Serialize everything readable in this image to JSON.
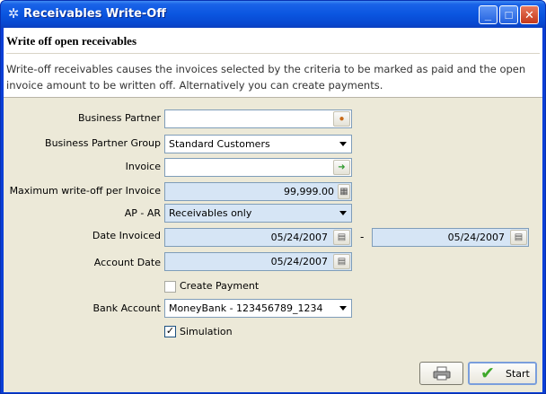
{
  "window": {
    "title": "Receivables Write-Off"
  },
  "header": {
    "title": "Write off open receivables",
    "description": "Write-off receivables causes the invoices selected by the criteria to be marked as paid and the open invoice amount to be written off. Alternatively you can create payments."
  },
  "form": {
    "business_partner": {
      "label": "Business Partner",
      "value": ""
    },
    "business_partner_group": {
      "label": "Business Partner Group",
      "value": "Standard Customers"
    },
    "invoice": {
      "label": "Invoice",
      "value": ""
    },
    "max_writeoff": {
      "label": "Maximum write-off per Invoice",
      "value": "99,999.00"
    },
    "ap_ar": {
      "label": "AP - AR",
      "value": "Receivables only"
    },
    "date_invoiced": {
      "label": "Date Invoiced",
      "from": "05/24/2007",
      "separator": "-",
      "to": "05/24/2007"
    },
    "account_date": {
      "label": "Account Date",
      "value": "05/24/2007"
    },
    "create_payment": {
      "label": "Create Payment",
      "checked": false
    },
    "bank_account": {
      "label": "Bank Account",
      "value": "MoneyBank - 123456789_1234"
    },
    "simulation": {
      "label": "Simulation",
      "checked": true
    }
  },
  "buttons": {
    "start": "Start"
  },
  "colors": {
    "titlebar": "#0a55e0",
    "mandatory_field": "#d6e5f5",
    "panel": "#ece9d8"
  }
}
